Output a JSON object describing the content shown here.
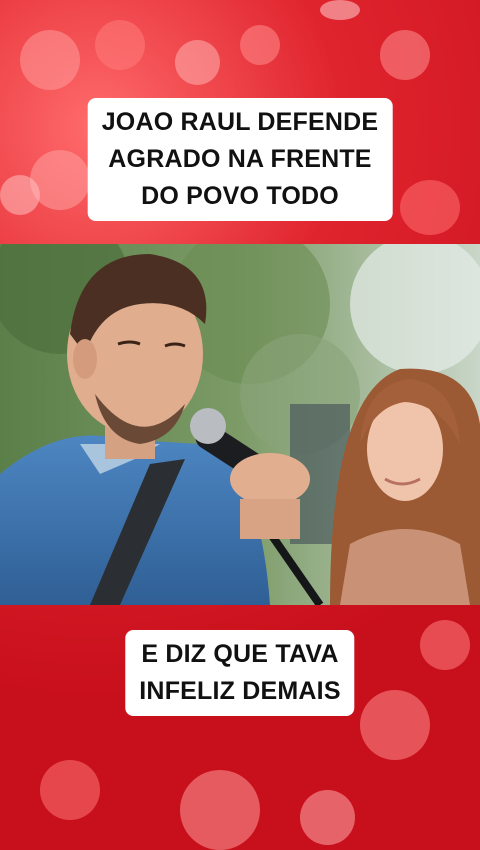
{
  "captions": {
    "top": [
      "JOAO RAUL DEFENDE",
      "AGRADO NA FRENTE",
      "DO POVO TODO"
    ],
    "bottom": [
      "E DIZ QUE TAVA",
      "INFELIZ DEMAIS"
    ]
  },
  "colors": {
    "background_red": "#d71a27",
    "bokeh_light": "#ff8a8a",
    "caption_bg": "#ffffff",
    "caption_text": "#111111"
  },
  "scene": {
    "subject_left": "man in denim shirt singing into microphone",
    "subject_right": "curly-haired woman looking at him"
  }
}
